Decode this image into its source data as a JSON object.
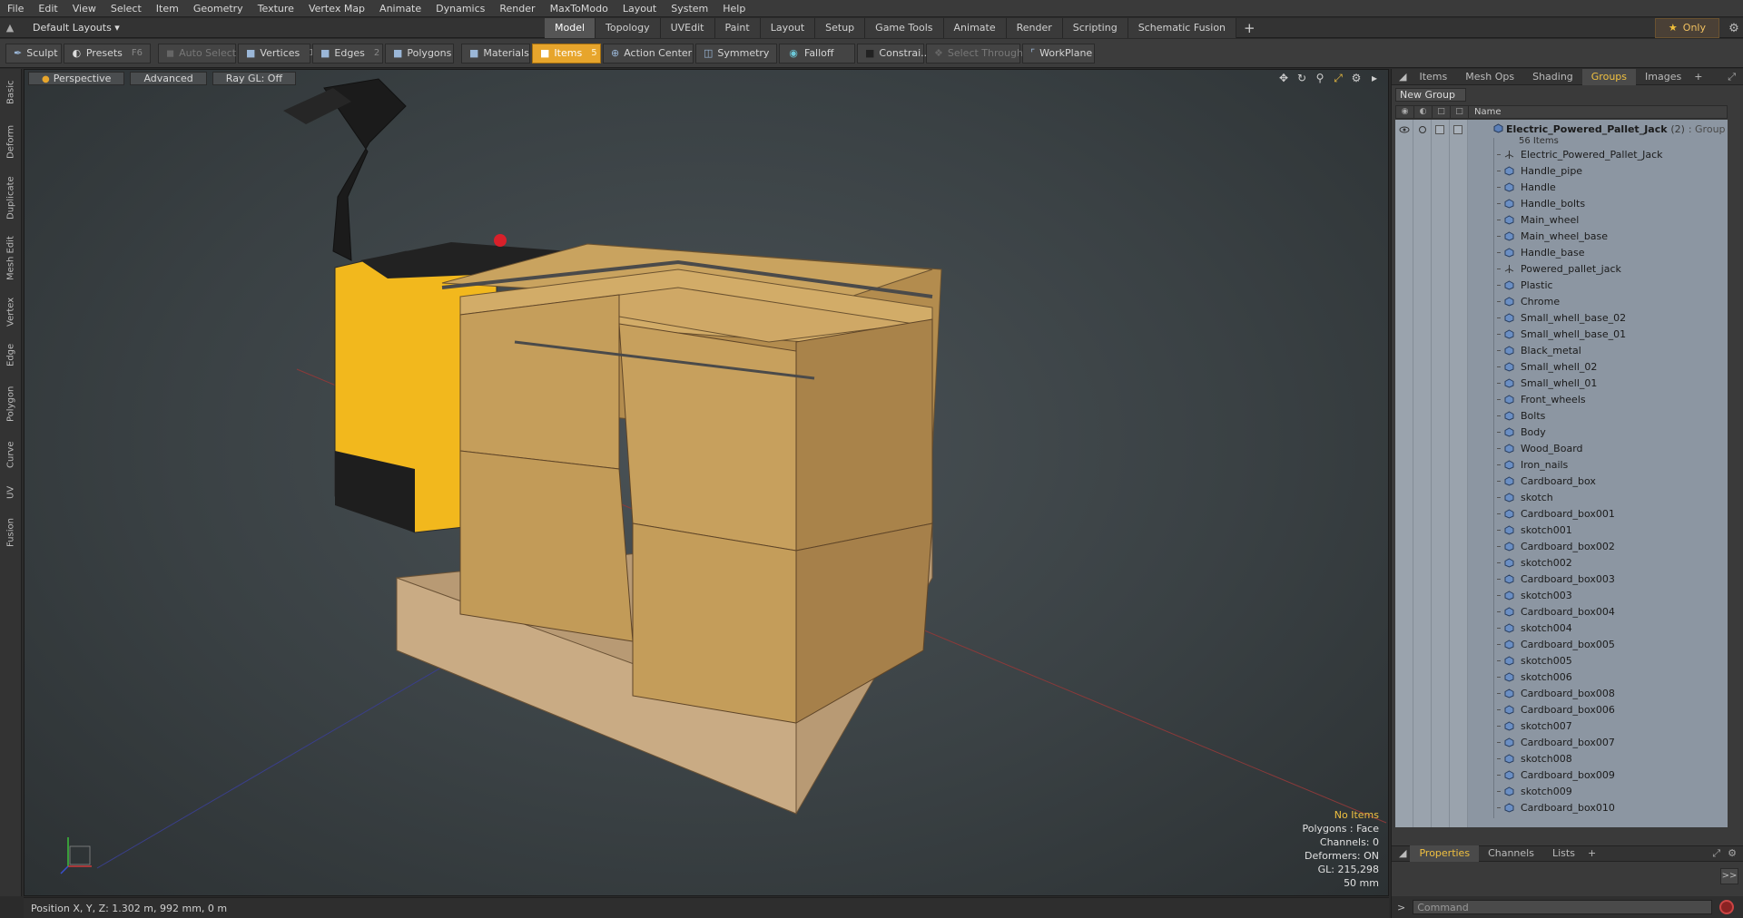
{
  "menubar": {
    "items": [
      "File",
      "Edit",
      "View",
      "Select",
      "Item",
      "Geometry",
      "Texture",
      "Vertex Map",
      "Animate",
      "Dynamics",
      "Render",
      "MaxToModo",
      "Layout",
      "System",
      "Help"
    ]
  },
  "layout": {
    "label": "Default Layouts ▾"
  },
  "tabs": [
    "Model",
    "Topology",
    "UVEdit",
    "Paint",
    "Layout",
    "Setup",
    "Game Tools",
    "Animate",
    "Render",
    "Scripting",
    "Schematic Fusion"
  ],
  "tabs_active": "Model",
  "only_button": {
    "label": "Only"
  },
  "toolbar": {
    "sculpt": "Sculpt",
    "presets": "Presets",
    "presets_key": "F6",
    "auto_select": "Auto Select",
    "vertices": "Vertices",
    "vertices_key": "1",
    "edges": "Edges",
    "edges_key": "2",
    "polygons": "Polygons",
    "materials": "Materials",
    "items": "Items",
    "items_key": "5",
    "action_center": "Action Center",
    "symmetry": "Symmetry",
    "falloff": "Falloff",
    "constraints": "Constrai...",
    "select_through": "Select Through",
    "workplane": "WorkPlane"
  },
  "left_tabs": [
    "Basic",
    "Deform",
    "Duplicate",
    "Mesh Edit",
    "Vertex",
    "Edge",
    "Polygon",
    "Curve",
    "UV",
    "Fusion"
  ],
  "viewport": {
    "view": "Perspective",
    "shading": "Advanced",
    "raygl": "Ray GL: Off",
    "info": {
      "no_items": "No Items",
      "polygons": "Polygons : Face",
      "channels": "Channels: 0",
      "deformers": "Deformers: ON",
      "gl": "GL: 215,298",
      "distance": "50 mm"
    }
  },
  "status": {
    "position": "Position X, Y, Z:  1.302 m, 992 mm, 0 m"
  },
  "right_panel": {
    "tabs": [
      "Items",
      "Mesh Ops",
      "Shading",
      "Groups",
      "Images"
    ],
    "active_tab": "Groups",
    "new_group": "New Group",
    "name_header": "Name",
    "group": {
      "name": "Electric_Powered_Pallet_Jack",
      "count": "(2)",
      "type": ": Group",
      "items": "56 Items"
    },
    "rows": [
      {
        "name": "Electric_Powered_Pallet_Jack",
        "icon": "locator"
      },
      {
        "name": "Handle_pipe",
        "icon": "mesh"
      },
      {
        "name": "Handle",
        "icon": "mesh"
      },
      {
        "name": "Handle_bolts",
        "icon": "mesh"
      },
      {
        "name": "Main_wheel",
        "icon": "mesh"
      },
      {
        "name": "Main_wheel_base",
        "icon": "mesh"
      },
      {
        "name": "Handle_base",
        "icon": "mesh"
      },
      {
        "name": "Powered_pallet_jack",
        "icon": "locator"
      },
      {
        "name": "Plastic",
        "icon": "mesh"
      },
      {
        "name": "Chrome",
        "icon": "mesh"
      },
      {
        "name": "Small_whell_base_02",
        "icon": "mesh"
      },
      {
        "name": "Small_whell_base_01",
        "icon": "mesh"
      },
      {
        "name": "Black_metal",
        "icon": "mesh"
      },
      {
        "name": "Small_whell_02",
        "icon": "mesh"
      },
      {
        "name": "Small_whell_01",
        "icon": "mesh"
      },
      {
        "name": "Front_wheels",
        "icon": "mesh"
      },
      {
        "name": "Bolts",
        "icon": "mesh"
      },
      {
        "name": "Body",
        "icon": "mesh"
      },
      {
        "name": "Wood_Board",
        "icon": "mesh"
      },
      {
        "name": "Iron_nails",
        "icon": "mesh"
      },
      {
        "name": "Cardboard_box",
        "icon": "mesh"
      },
      {
        "name": "skotch",
        "icon": "mesh"
      },
      {
        "name": "Cardboard_box001",
        "icon": "mesh"
      },
      {
        "name": "skotch001",
        "icon": "mesh"
      },
      {
        "name": "Cardboard_box002",
        "icon": "mesh"
      },
      {
        "name": "skotch002",
        "icon": "mesh"
      },
      {
        "name": "Cardboard_box003",
        "icon": "mesh"
      },
      {
        "name": "skotch003",
        "icon": "mesh"
      },
      {
        "name": "Cardboard_box004",
        "icon": "mesh"
      },
      {
        "name": "skotch004",
        "icon": "mesh"
      },
      {
        "name": "Cardboard_box005",
        "icon": "mesh"
      },
      {
        "name": "skotch005",
        "icon": "mesh"
      },
      {
        "name": "skotch006",
        "icon": "mesh"
      },
      {
        "name": "Cardboard_box008",
        "icon": "mesh"
      },
      {
        "name": "Cardboard_box006",
        "icon": "mesh"
      },
      {
        "name": "skotch007",
        "icon": "mesh"
      },
      {
        "name": "Cardboard_box007",
        "icon": "mesh"
      },
      {
        "name": "skotch008",
        "icon": "mesh"
      },
      {
        "name": "Cardboard_box009",
        "icon": "mesh"
      },
      {
        "name": "skotch009",
        "icon": "mesh"
      },
      {
        "name": "Cardboard_box010",
        "icon": "mesh"
      }
    ],
    "bottom_tabs": [
      "Properties",
      "Channels",
      "Lists"
    ],
    "bottom_active": "Properties",
    "command_placeholder": "Command"
  },
  "colors": {
    "accent": "#e7a52c",
    "active_tab_text": "#f0c040",
    "list_bg": "#8c96a2",
    "viewport_bg": "#3a4144"
  }
}
